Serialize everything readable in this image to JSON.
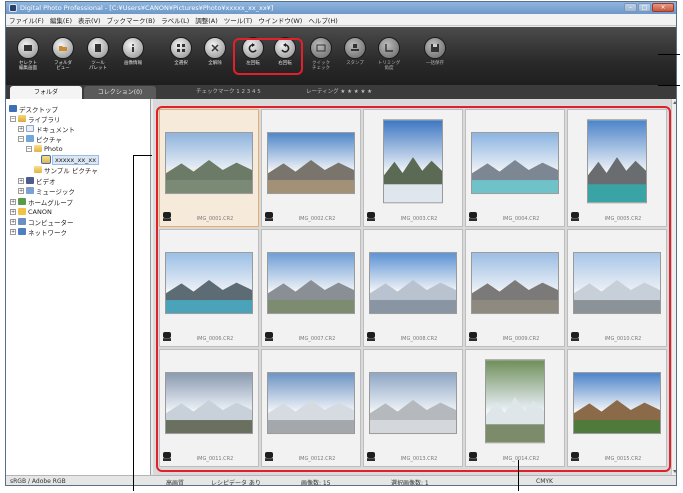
{
  "window": {
    "title": "Digital Photo Professional - [C:¥Users¥CANON¥Pictures¥Photo¥xxxxx_xx_xx¥]",
    "controls": [
      "–",
      "□",
      "×"
    ]
  },
  "menu": [
    "ファイル(F)",
    "編集(E)",
    "表示(V)",
    "ブックマーク(B)",
    "ラベル(L)",
    "調整(A)",
    "ツール(T)",
    "ウインドウ(W)",
    "ヘルプ(H)"
  ],
  "toolbar": {
    "items": [
      {
        "label": "セレクト\n編集画面",
        "icon": "select-edit-icon"
      },
      {
        "label": "フォルダ\nビュー",
        "icon": "folder-view-icon"
      },
      {
        "label": "ツール\nパレット",
        "icon": "tool-palette-icon"
      },
      {
        "label": "画像情報",
        "icon": "info-icon"
      },
      {
        "label": "全選択",
        "icon": "select-all-icon"
      },
      {
        "label": "全解除",
        "icon": "deselect-all-icon"
      },
      {
        "label": "左回転",
        "icon": "rotate-left-icon"
      },
      {
        "label": "右回転",
        "icon": "rotate-right-icon"
      },
      {
        "label": "クイック\nチェック",
        "icon": "quick-check-icon"
      },
      {
        "label": "スタンプ",
        "icon": "stamp-icon"
      },
      {
        "label": "トリミング\n角度",
        "icon": "trim-angle-icon"
      },
      {
        "label": "一括保存",
        "icon": "batch-save-icon"
      }
    ]
  },
  "tabs": [
    {
      "label": "フォルダ",
      "active": true
    },
    {
      "label": "コレクション(0)",
      "active": false
    }
  ],
  "filters": {
    "checkmark": "チェックマーク  1  2  3  4  5",
    "rating": "レーティング  ★ ★ ★ ★ ★"
  },
  "tree": [
    {
      "label": "デスクトップ",
      "icon": "desktop-icon",
      "expander": ""
    },
    {
      "label": "ライブラリ",
      "icon": "library-icon",
      "expander": "−"
    },
    {
      "label": "ドキュメント",
      "icon": "documents-icon",
      "expander": "+"
    },
    {
      "label": "ピクチャ",
      "icon": "pictures-icon",
      "expander": "−"
    },
    {
      "label": "Photo",
      "icon": "folder-icon",
      "expander": "−"
    },
    {
      "label": "xxxxx_xx_xx",
      "icon": "folder-icon",
      "expander": ""
    },
    {
      "label": "サンプル ピクチャ",
      "icon": "folder-icon",
      "expander": ""
    },
    {
      "label": "ビデオ",
      "icon": "videos-icon",
      "expander": "+"
    },
    {
      "label": "ミュージック",
      "icon": "music-icon",
      "expander": "+"
    },
    {
      "label": "ホームグループ",
      "icon": "homegroup-icon",
      "expander": "+"
    },
    {
      "label": "CANON",
      "icon": "user-folder-icon",
      "expander": "+"
    },
    {
      "label": "コンピューター",
      "icon": "computer-icon",
      "expander": "+"
    },
    {
      "label": "ネットワーク",
      "icon": "network-icon",
      "expander": "+"
    }
  ],
  "thumbnails": [
    {
      "name": "IMG_0001.CR2",
      "orientation": "landscape",
      "selected": true,
      "sky": "#8fb3dc",
      "land": "#6c7a68",
      "water": "#7b8a74"
    },
    {
      "name": "IMG_0002.CR2",
      "orientation": "landscape",
      "selected": false,
      "sky": "#4f86c8",
      "land": "#7a756c",
      "water": "#a29177"
    },
    {
      "name": "IMG_0003.CR2",
      "orientation": "portrait",
      "selected": false,
      "sky": "#3d77c2",
      "land": "#5b6a55",
      "water": "#dfe6ee"
    },
    {
      "name": "IMG_0004.CR2",
      "orientation": "landscape",
      "selected": false,
      "sky": "#8cb4e0",
      "land": "#7d8794",
      "water": "#6fc2c8"
    },
    {
      "name": "IMG_0005.CR2",
      "orientation": "portrait",
      "selected": false,
      "sky": "#4c84c9",
      "land": "#6a6d70",
      "water": "#3aa3a6"
    },
    {
      "name": "IMG_0006.CR2",
      "orientation": "landscape",
      "selected": false,
      "sky": "#9bbfe6",
      "land": "#5d6b74",
      "water": "#4aa3b8"
    },
    {
      "name": "IMG_0007.CR2",
      "orientation": "landscape",
      "selected": false,
      "sky": "#6f9fd6",
      "land": "#8a8f96",
      "water": "#7d8c70"
    },
    {
      "name": "IMG_0008.CR2",
      "orientation": "landscape",
      "selected": false,
      "sky": "#5c93d3",
      "land": "#b9c3cf",
      "water": "#8995a3"
    },
    {
      "name": "IMG_0009.CR2",
      "orientation": "landscape",
      "selected": false,
      "sky": "#9cbde3",
      "land": "#7b7a78",
      "water": "#8f8a80"
    },
    {
      "name": "IMG_0010.CR2",
      "orientation": "landscape",
      "selected": false,
      "sky": "#a9c6e8",
      "land": "#c7cfd8",
      "water": "#8c9398"
    },
    {
      "name": "IMG_0011.CR2",
      "orientation": "landscape",
      "selected": false,
      "sky": "#8a9ab0",
      "land": "#c8d0da",
      "water": "#6a7060"
    },
    {
      "name": "IMG_0012.CR2",
      "orientation": "landscape",
      "selected": false,
      "sky": "#6e93c4",
      "land": "#d6dbe1",
      "water": "#a4a8ad"
    },
    {
      "name": "IMG_0013.CR2",
      "orientation": "landscape",
      "selected": false,
      "sky": "#8fa6c4",
      "land": "#b5b8bd",
      "water": "#d4d7dc"
    },
    {
      "name": "IMG_0014.CR2",
      "orientation": "portrait",
      "selected": false,
      "sky": "#6f8f5a",
      "land": "#dfe6ea",
      "water": "#7c8c6a"
    },
    {
      "name": "IMG_0015.CR2",
      "orientation": "landscape",
      "selected": false,
      "sky": "#4e84c9",
      "land": "#8a6a48",
      "water": "#4f7a3c"
    }
  ],
  "status": {
    "color_space": "sRGB / Adobe RGB",
    "quality": "高画質",
    "recipe": "レシピデータ あり",
    "count": "画像数: 15",
    "selected_count": "選択画像数: 1",
    "cmyk": "CMYK"
  },
  "colors": {
    "highlight": "#e0202a",
    "toolbar_bg": "#2a2a2a",
    "selected_cell": "#e3b06c"
  }
}
